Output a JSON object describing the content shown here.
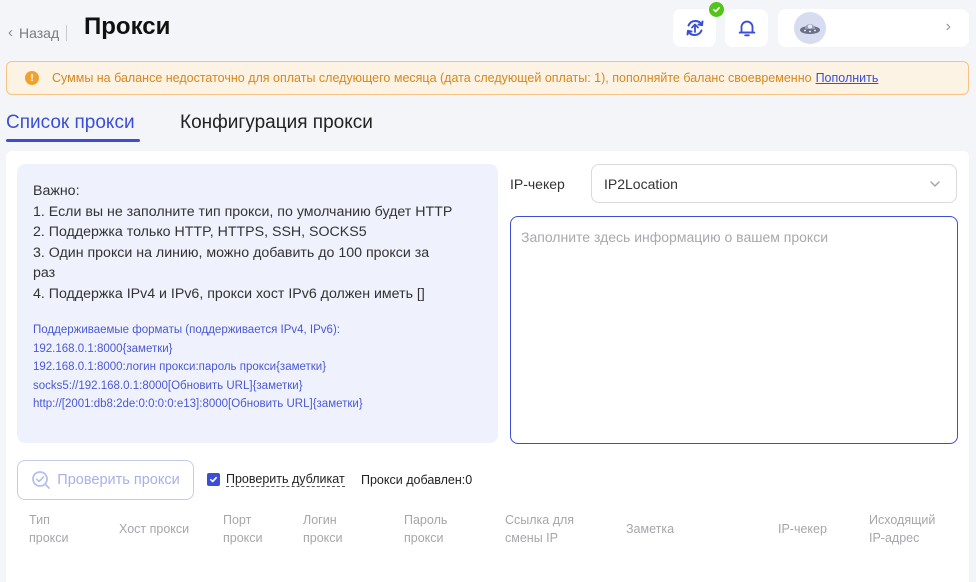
{
  "header": {
    "back_label": "Назад",
    "title": "Прокси"
  },
  "alert": {
    "text": "Суммы на балансе недостаточно для оплаты следующего месяца (дата следующей оплаты: 1), пополняйте баланс своевременно",
    "link_label": "Пополнить"
  },
  "tabs": [
    {
      "label": "Список прокси",
      "active": true
    },
    {
      "label": "Конфигурация прокси",
      "active": false
    }
  ],
  "info": {
    "lines": [
      "Важно:",
      "1. Если вы не заполните тип прокси, по умолчанию будет HTTP",
      "2. Поддержка только HTTP, HTTPS, SSH, SOCKS5",
      "3. Один прокси на линию, можно добавить до 100 прокси за",
      "раз",
      "4. Поддержка IPv4 и IPv6, прокси хост IPv6 должен иметь []"
    ],
    "formats": [
      "Поддерживаемые форматы (поддерживается IPv4, IPv6):",
      "192.168.0.1:8000{заметки}",
      "192.168.0.1:8000:логин прокси:пароль прокси{заметки}",
      "socks5://192.168.0.1:8000[Обновить URL]{заметки}",
      "http://[2001:db8:2de:0:0:0:0:e13]:8000[Обновить URL]{заметки}"
    ]
  },
  "ip_checker": {
    "label": "IP-чекер",
    "value": "IP2Location"
  },
  "proxy_input": {
    "placeholder": "Заполните здесь информацию о вашем прокси",
    "value": ""
  },
  "actions": {
    "check_label": "Проверить прокси",
    "duplicate_label": "Проверить дубликат",
    "duplicate_checked": true,
    "added_label": "Прокси добавлен:",
    "added_count": "0"
  },
  "table": {
    "columns": [
      [
        "Тип",
        "прокси"
      ],
      [
        "Хост прокси"
      ],
      [
        "Порт",
        "прокси"
      ],
      [
        "Логин",
        "прокси"
      ],
      [
        "Пароль",
        "прокси"
      ],
      [
        "Ссылка для",
        "смены IP"
      ],
      [
        "Заметка"
      ],
      [
        "IP-чекер"
      ],
      [
        "Исходящий",
        "IP-адрес"
      ]
    ]
  },
  "colors": {
    "accent": "#3a4fd6",
    "warning_text": "#d5881f",
    "warning_bg": "#fdf3e4",
    "success": "#52c41a"
  }
}
